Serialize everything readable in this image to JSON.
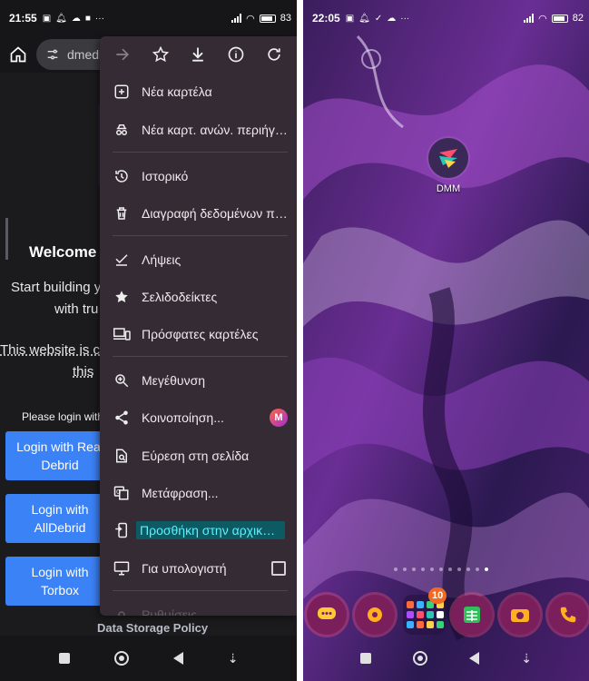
{
  "left_screen": {
    "status": {
      "time": "21:55",
      "battery": "83"
    },
    "url_text": "dmedia",
    "page": {
      "welcome": "Welcome t",
      "line1": "Start building y",
      "line2": "with tru",
      "line3": "This website is c",
      "line4": "this",
      "please": "Please login with",
      "login_buttons": [
        "Login with Real Debrid",
        "Login with AllDebrid",
        "Login with Torbox"
      ],
      "data_storage": "Data Storage Policy"
    },
    "menu": {
      "toolbar": [
        "forward-icon",
        "star-icon",
        "download-icon",
        "info-icon",
        "refresh-icon"
      ],
      "items": [
        {
          "icon": "new-tab-icon",
          "label": "Νέα καρτέλα"
        },
        {
          "icon": "incognito-icon",
          "label": "Νέα καρτ. ανών. περιήγησης"
        },
        {
          "icon": "history-icon",
          "label": "Ιστορικό"
        },
        {
          "icon": "trash-icon",
          "label": "Διαγραφή δεδομένων περιήγησης"
        },
        {
          "icon": "downloads-check-icon",
          "label": "Λήψεις"
        },
        {
          "icon": "bookmark-star-icon",
          "label": "Σελιδοδείκτες"
        },
        {
          "icon": "devices-icon",
          "label": "Πρόσφατες καρτέλες"
        },
        {
          "icon": "zoom-icon",
          "label": "Μεγέθυνση"
        },
        {
          "icon": "share-icon",
          "label": "Κοινοποίηση..."
        },
        {
          "icon": "find-page-icon",
          "label": "Εύρεση στη σελίδα"
        },
        {
          "icon": "translate-icon",
          "label": "Μετάφραση..."
        },
        {
          "icon": "add-home-icon",
          "label": "Προσθήκη στην αρχική οθόνη"
        },
        {
          "icon": "desktop-icon",
          "label": "Για υπολογιστή"
        },
        {
          "icon": "settings-icon",
          "label": "Ρυθμίσεις"
        }
      ],
      "share_badge": "M"
    }
  },
  "right_screen": {
    "status": {
      "time": "22:05",
      "battery": "82"
    },
    "app_label": "DMM",
    "folder_badge": "10",
    "colors": {
      "wallpaper_purple": "#7a3fa8",
      "wallpaper_deep": "#241246",
      "dock_ring": "#ff5078"
    }
  }
}
